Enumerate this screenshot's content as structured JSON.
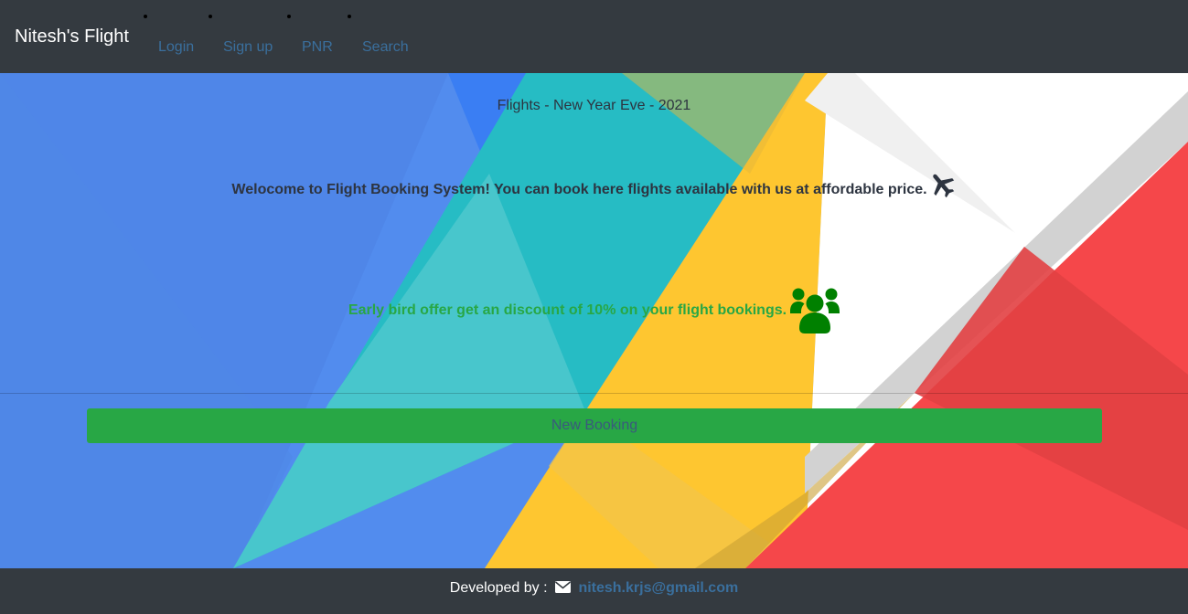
{
  "navbar": {
    "brand": "Nitesh's Flight",
    "links": [
      "Login",
      "Sign up",
      "PNR",
      "Search"
    ]
  },
  "hero": {
    "subtitle": "Flights - New Year Eve - 2021",
    "welcome": "Welocome to Flight Booking System! You can book here flights available with us at affordable price.",
    "offer": "Early bird offer get an discount of 10% on your flight bookings.",
    "new_booking_label": "New Booking"
  },
  "footer": {
    "label": "Developed by :",
    "email": "nitesh.krjs@gmail.com"
  },
  "icons": {
    "plane": "plane-icon",
    "users": "users-icon",
    "mail": "envelope-icon"
  },
  "colors": {
    "navbar_bg": "#343a40",
    "link": "#3a6f9d",
    "accent_green": "#28a745",
    "icon_green": "#008000",
    "blue_panel": "#528cee",
    "teal_panel": "#26bcc4",
    "yellow_panel": "#fec630",
    "red_panel": "#f5474a"
  }
}
